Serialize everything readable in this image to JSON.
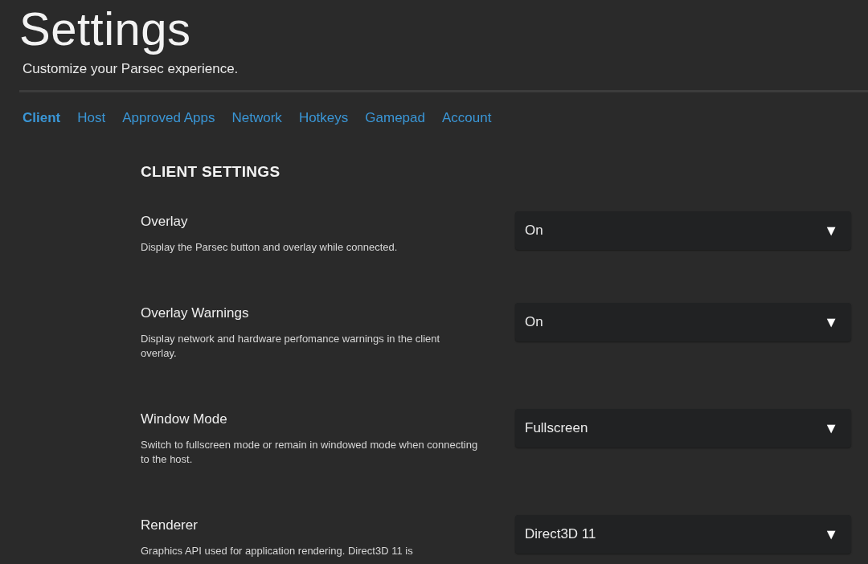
{
  "header": {
    "title": "Settings",
    "subtitle": "Customize your Parsec experience."
  },
  "tabs": [
    {
      "label": "Client",
      "selected": true
    },
    {
      "label": "Host",
      "selected": false
    },
    {
      "label": "Approved Apps",
      "selected": false
    },
    {
      "label": "Network",
      "selected": false
    },
    {
      "label": "Hotkeys",
      "selected": false
    },
    {
      "label": "Gamepad",
      "selected": false
    },
    {
      "label": "Account",
      "selected": false
    }
  ],
  "section": {
    "heading": "CLIENT SETTINGS",
    "settings": [
      {
        "label": "Overlay",
        "description": "Display the Parsec button and overlay while connected.",
        "value": "On",
        "arrow": "▼"
      },
      {
        "label": "Overlay Warnings",
        "description": "Display network and hardware perfomance warnings in the client overlay.",
        "value": "On",
        "arrow": "▼"
      },
      {
        "label": "Window Mode",
        "description": "Switch to fullscreen mode or remain in windowed mode when connecting to the host.",
        "value": "Fullscreen",
        "arrow": "▼"
      },
      {
        "label": "Renderer",
        "description": "Graphics API used for application rendering. Direct3D 11 is",
        "value": "Direct3D 11",
        "arrow": "▼"
      }
    ]
  }
}
